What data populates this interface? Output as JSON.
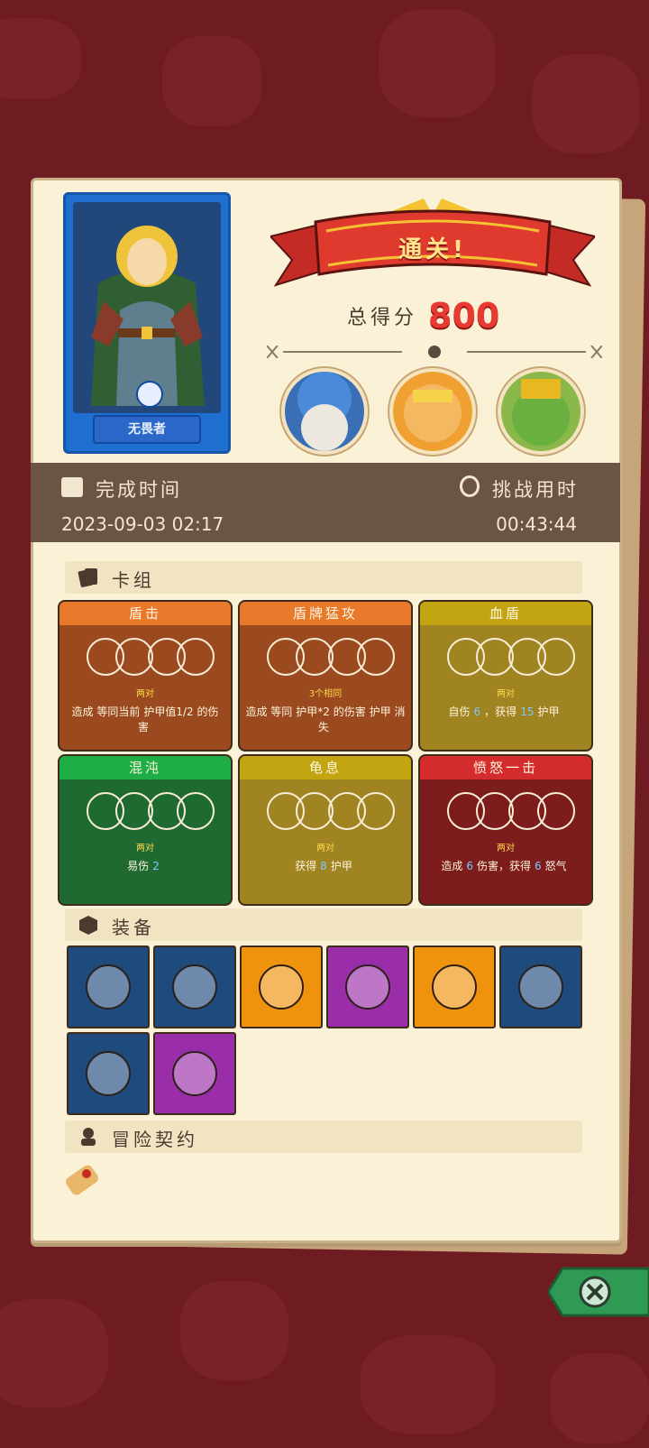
{
  "result_title": "通关!",
  "score": {
    "label": "总得分",
    "value": "800"
  },
  "hero": {
    "name": "无畏者"
  },
  "bosses": [
    "mushroom-wizard-boss",
    "tiger-warrior-boss",
    "goblin-king-boss"
  ],
  "time": {
    "complete_label": "完成时间",
    "complete_value": "2023-09-03 02:17",
    "challenge_label": "挑战用时",
    "challenge_value": "00:43:44"
  },
  "deck": {
    "title": "卡组",
    "cards": [
      {
        "name": "盾击",
        "sub": "两对",
        "desc": "造成 等同当前",
        "desc2": "护甲值1/2 的伤害",
        "color": "#9a4a1e",
        "header": "#e8782a"
      },
      {
        "name": "盾牌猛攻",
        "sub": "3个相同",
        "desc": "造成 等同",
        "desc2": "护甲*2 的伤害",
        "desc3": "护甲 消失",
        "color": "#9a4a1e",
        "header": "#e8782a"
      },
      {
        "name": "血盾",
        "sub": "两对",
        "desc": "自伤",
        "desc_value": "6",
        "desc2": "，获得",
        "desc2_value": "15",
        "desc3": "护甲",
        "color": "#a08422",
        "header": "#c3a512"
      },
      {
        "name": "混沌",
        "sub": "两对",
        "desc_value": "2",
        "desc": "易伤",
        "color": "#1f6a31",
        "header": "#1fae45"
      },
      {
        "name": "龟息",
        "sub": "两对",
        "desc": "获得",
        "desc_value": "8",
        "desc2": "护甲",
        "color": "#a08422",
        "header": "#c3a512"
      },
      {
        "name": "愤怒一击",
        "sub": "两对",
        "desc": "造成",
        "desc_value": "6",
        "desc2": "伤害，获得",
        "desc2_value": "6",
        "desc3": "怒气",
        "color": "#7d1c1c",
        "header": "#d42c2c"
      }
    ]
  },
  "equipment": {
    "title": "装备",
    "items": [
      {
        "name": "dice-box-icon",
        "bg": "#1f4a7e"
      },
      {
        "name": "pink-d20-icon",
        "bg": "#1f4a7e"
      },
      {
        "name": "vase-icon",
        "bg": "#f0930c"
      },
      {
        "name": "wooden-shield-icon",
        "bg": "#9a2ea8"
      },
      {
        "name": "green-gem-icon",
        "bg": "#f0930c"
      },
      {
        "name": "skull-book-icon",
        "bg": "#1f4a7e"
      },
      {
        "name": "horn-icon",
        "bg": "#1f4a7e"
      },
      {
        "name": "tunic-icon",
        "bg": "#9a2ea8"
      }
    ]
  },
  "contracts": {
    "title": "冒险契约"
  }
}
